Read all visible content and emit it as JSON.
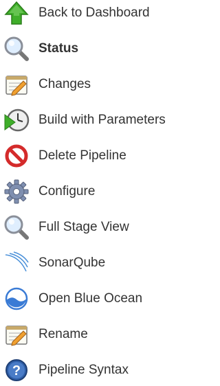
{
  "sidebar": {
    "items": [
      {
        "label": "Back to Dashboard",
        "icon": "up-arrow-icon"
      },
      {
        "label": "Status",
        "icon": "magnifier-icon",
        "selected": true
      },
      {
        "label": "Changes",
        "icon": "notepad-edit-icon"
      },
      {
        "label": "Build with Parameters",
        "icon": "clock-play-icon"
      },
      {
        "label": "Delete Pipeline",
        "icon": "no-entry-icon"
      },
      {
        "label": "Configure",
        "icon": "gear-icon"
      },
      {
        "label": "Full Stage View",
        "icon": "magnifier-icon"
      },
      {
        "label": "SonarQube",
        "icon": "sonarqube-icon"
      },
      {
        "label": "Open Blue Ocean",
        "icon": "blue-ocean-icon"
      },
      {
        "label": "Rename",
        "icon": "notepad-edit-icon"
      },
      {
        "label": "Pipeline Syntax",
        "icon": "help-icon"
      }
    ]
  },
  "colors": {
    "text": "#333333",
    "arrow_green": "#3fae2a",
    "delete_red": "#d42b2b",
    "blue": "#3a7bd5"
  }
}
